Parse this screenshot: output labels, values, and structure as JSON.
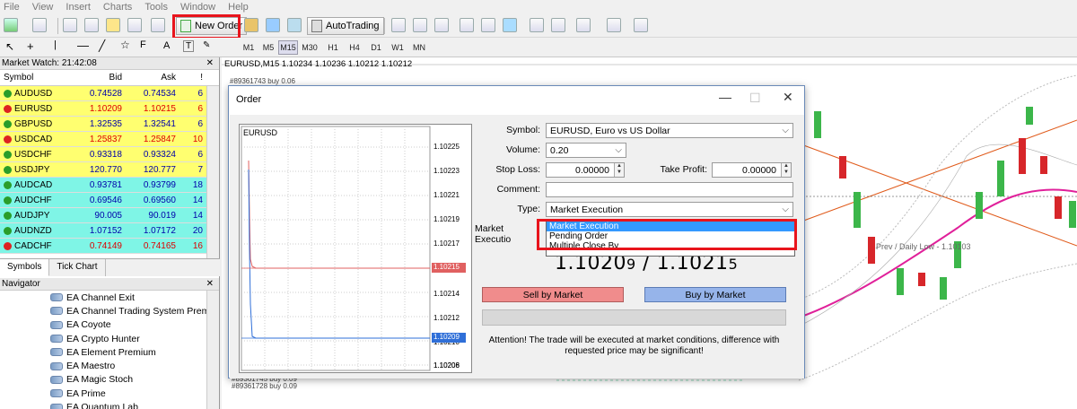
{
  "menu": [
    "File",
    "View",
    "Insert",
    "Charts",
    "Tools",
    "Window",
    "Help"
  ],
  "toolbar": {
    "new_order": "New Order",
    "autotrading": "AutoTrading"
  },
  "timeframes": [
    "M1",
    "M5",
    "M15",
    "M30",
    "H1",
    "H4",
    "D1",
    "W1",
    "MN"
  ],
  "active_timeframe": "M15",
  "market_watch": {
    "title": "Market Watch: 21:42:08",
    "headers": [
      "Symbol",
      "Bid",
      "Ask",
      "!"
    ],
    "rows": [
      {
        "symbol": "AUDUSD",
        "bid": "0.74528",
        "ask": "0.74534",
        "spread": "6",
        "dir": "up",
        "color": "#ffff70",
        "red": false
      },
      {
        "symbol": "EURUSD",
        "bid": "1.10209",
        "ask": "1.10215",
        "spread": "6",
        "dir": "dn",
        "color": "#ffff70",
        "red": true
      },
      {
        "symbol": "GBPUSD",
        "bid": "1.32535",
        "ask": "1.32541",
        "spread": "6",
        "dir": "up",
        "color": "#ffff70",
        "red": false
      },
      {
        "symbol": "USDCAD",
        "bid": "1.25837",
        "ask": "1.25847",
        "spread": "10",
        "dir": "dn",
        "color": "#ffff70",
        "red": true
      },
      {
        "symbol": "USDCHF",
        "bid": "0.93318",
        "ask": "0.93324",
        "spread": "6",
        "dir": "up",
        "color": "#ffff70",
        "red": false
      },
      {
        "symbol": "USDJPY",
        "bid": "120.770",
        "ask": "120.777",
        "spread": "7",
        "dir": "up",
        "color": "#ffff70",
        "red": false
      },
      {
        "symbol": "AUDCAD",
        "bid": "0.93781",
        "ask": "0.93799",
        "spread": "18",
        "dir": "up",
        "color": "#7ff5e6",
        "red": false
      },
      {
        "symbol": "AUDCHF",
        "bid": "0.69546",
        "ask": "0.69560",
        "spread": "14",
        "dir": "up",
        "color": "#7ff5e6",
        "red": false
      },
      {
        "symbol": "AUDJPY",
        "bid": "90.005",
        "ask": "90.019",
        "spread": "14",
        "dir": "up",
        "color": "#7ff5e6",
        "red": false
      },
      {
        "symbol": "AUDNZD",
        "bid": "1.07152",
        "ask": "1.07172",
        "spread": "20",
        "dir": "up",
        "color": "#7ff5e6",
        "red": false
      },
      {
        "symbol": "CADCHF",
        "bid": "0.74149",
        "ask": "0.74165",
        "spread": "16",
        "dir": "dn",
        "color": "#7ff5e6",
        "red": true
      }
    ],
    "tabs": [
      "Symbols",
      "Tick Chart"
    ]
  },
  "navigator": {
    "title": "Navigator",
    "items": [
      "EA Channel Exit",
      "EA Channel Trading System Premu",
      "EA Coyote",
      "EA Crypto Hunter",
      "EA Element Premium",
      "EA Maestro",
      "EA Magic Stoch",
      "EA Prime",
      "EA Quantum Lab"
    ]
  },
  "chart": {
    "title": "EURUSD,M15  1.10234 1.10236 1.10212 1.10212",
    "order_label": "#89361743 buy 0.06",
    "order_label_b1": "#89361745 buy 0.09",
    "order_label_b2": "#89361728 buy 0.09",
    "daily_low": "Prev / Daily Low - 1.10103"
  },
  "dialog": {
    "title": "Order",
    "mini_symbol": "EURUSD",
    "mini_prices": [
      "1.10225",
      "1.10223",
      "1.10221",
      "1.10219",
      "1.10217",
      "1.10215",
      "1.10214",
      "1.10212",
      "1.10210",
      "1.10209",
      "1.10208",
      "1.10206"
    ],
    "mini_ask_tag": "1.10215",
    "mini_bid_tag": "1.10209",
    "symbol_label": "Symbol:",
    "symbol_value": "EURUSD, Euro vs US Dollar",
    "volume_label": "Volume:",
    "volume_value": "0.20",
    "sl_label": "Stop Loss:",
    "sl_value": "0.00000",
    "tp_label": "Take Profit:",
    "tp_value": "0.00000",
    "comment_label": "Comment:",
    "comment_value": "",
    "type_label": "Type:",
    "type_value": "Market Execution",
    "type_options": [
      "Market Execution",
      "Pending Order",
      "Multiple Close By"
    ],
    "exec_label": "Market Executio",
    "price_bid_main": "1.1020",
    "price_bid_small": "9",
    "price_sep": " / ",
    "price_ask_main": "1.1021",
    "price_ask_small": "5",
    "sell_label": "Sell by Market",
    "buy_label": "Buy by Market",
    "attention": "Attention! The trade will be executed at market conditions, difference with requested price may be significant!"
  }
}
